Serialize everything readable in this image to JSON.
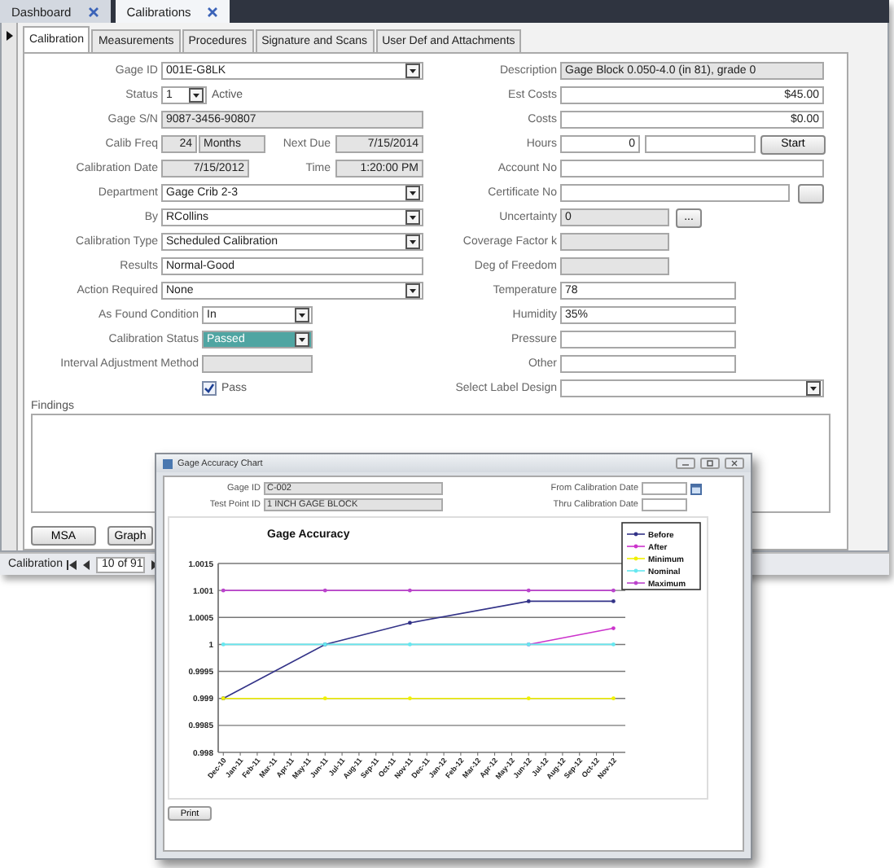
{
  "document_tabs": [
    {
      "label": "Dashboard",
      "selected": false
    },
    {
      "label": "Calibrations",
      "selected": true
    }
  ],
  "form_tabs": [
    {
      "label": "Calibration",
      "selected": true
    },
    {
      "label": "Measurements",
      "selected": false
    },
    {
      "label": "Procedures",
      "selected": false
    },
    {
      "label": "Signature and Scans",
      "selected": false
    },
    {
      "label": "User Def and Attachments",
      "selected": false
    }
  ],
  "left_fields": [
    {
      "kind": "combo",
      "label": "Gage ID",
      "value": "001E-G8LK"
    },
    {
      "kind": "status",
      "label": "Status",
      "value": "1",
      "note": "Active"
    },
    {
      "kind": "readonly",
      "label": "Gage S/N",
      "value": "9087-3456-90807"
    },
    {
      "kind": "pair",
      "label": "Calib Freq",
      "value": "24",
      "unit": "Months",
      "label2": "Next Due",
      "value2": "7/15/2014"
    },
    {
      "kind": "pair",
      "label": "Calibration Date",
      "value": "7/15/2012",
      "label2": "Time",
      "value2": "1:20:00 PM"
    },
    {
      "kind": "combo",
      "label": "Department",
      "value": "Gage Crib 2-3"
    },
    {
      "kind": "combo",
      "label": "By",
      "value": "RCollins"
    },
    {
      "kind": "combo",
      "label": "Calibration Type",
      "value": "Scheduled Calibration"
    },
    {
      "kind": "text",
      "label": "Results",
      "value": "Normal-Good"
    },
    {
      "kind": "combo",
      "label": "Action Required",
      "value": "None"
    },
    {
      "kind": "combo-narrow",
      "label": "As Found Condition",
      "value": "In",
      "highlighted": false
    },
    {
      "kind": "combo-narrow",
      "label": "Calibration Status",
      "value": "Passed",
      "highlighted": true
    },
    {
      "kind": "readonly-narrow",
      "label": "Interval Adjustment Method"
    },
    {
      "kind": "checkbox",
      "label": "Pass",
      "checked": true
    }
  ],
  "right_fields": [
    {
      "kind": "readonly",
      "label": "Description",
      "value": "Gage Block 0.050-4.0 (in 81), grade 0"
    },
    {
      "kind": "text-right",
      "label": "Est Costs",
      "value": "$45.00"
    },
    {
      "kind": "text-right",
      "label": "Costs",
      "value": "$0.00"
    },
    {
      "kind": "hours",
      "label": "Hours",
      "value": "0",
      "button": "Start"
    },
    {
      "kind": "text",
      "label": "Account No"
    },
    {
      "kind": "text-button",
      "label": "Certificate No"
    },
    {
      "kind": "readonly-button",
      "label": "Uncertainty",
      "value": "0",
      "button": "..."
    },
    {
      "kind": "readonly-medium",
      "label": "Coverage Factor k"
    },
    {
      "kind": "readonly-medium",
      "label": "Deg of Freedom"
    },
    {
      "kind": "text-medium",
      "label": "Temperature",
      "value": "78"
    },
    {
      "kind": "text-medium",
      "label": "Humidity",
      "value": "35%"
    },
    {
      "kind": "text-medium",
      "label": "Pressure"
    },
    {
      "kind": "text-medium",
      "label": "Other"
    },
    {
      "kind": "combo",
      "label": "Select Label Design"
    }
  ],
  "findings": {
    "label": "Findings"
  },
  "buttons": [
    "MSA",
    "Graph"
  ],
  "navigation": {
    "label": "Calibration",
    "position": "10 of 91"
  },
  "chart_window": {
    "title": "Gage Accuracy Chart",
    "fields": [
      {
        "label": "Gage ID",
        "value": "C-002"
      },
      {
        "label": "Test Point ID",
        "value": "1 INCH GAGE BLOCK"
      }
    ],
    "date_fields": [
      {
        "label": "From Calibration Date",
        "calendar": true
      },
      {
        "label": "Thru Calibration Date",
        "calendar": false
      }
    ],
    "chart_data": {
      "type": "line",
      "title": "Gage Accuracy",
      "categories": [
        "Dec-10",
        "Jan-11",
        "Feb-11",
        "Mar-11",
        "Apr-11",
        "May-11",
        "Jun-11",
        "Jul-11",
        "Aug-11",
        "Sep-11",
        "Oct-11",
        "Nov-11",
        "Dec-11",
        "Jan-12",
        "Feb-12",
        "Mar-12",
        "Apr-12",
        "May-12",
        "Jun-12",
        "Jul-12",
        "Aug-12",
        "Sep-12",
        "Oct-12",
        "Nov-12"
      ],
      "series": [
        {
          "name": "Before",
          "color": "#333388",
          "values": [
            0.999,
            null,
            null,
            null,
            null,
            null,
            1,
            null,
            null,
            null,
            null,
            1.0004,
            null,
            null,
            null,
            null,
            null,
            null,
            1.0008,
            null,
            null,
            null,
            null,
            1.0008
          ]
        },
        {
          "name": "After",
          "color": "#cc33cc",
          "values": [
            null,
            null,
            null,
            null,
            null,
            null,
            null,
            null,
            null,
            null,
            null,
            null,
            null,
            null,
            null,
            null,
            null,
            null,
            1,
            null,
            null,
            null,
            null,
            1.0003
          ]
        },
        {
          "name": "Minimum",
          "color": "#f0f000",
          "values": [
            0.999,
            null,
            null,
            null,
            null,
            null,
            0.999,
            null,
            null,
            null,
            null,
            0.999,
            null,
            null,
            null,
            null,
            null,
            null,
            0.999,
            null,
            null,
            null,
            null,
            0.999
          ]
        },
        {
          "name": "Nominal",
          "color": "#66e8f0",
          "values": [
            1,
            null,
            null,
            null,
            null,
            null,
            1,
            null,
            null,
            null,
            null,
            1,
            null,
            null,
            null,
            null,
            null,
            null,
            1,
            null,
            null,
            null,
            null,
            1
          ]
        },
        {
          "name": "Maximum",
          "color": "#bb44cc",
          "values": [
            1.001,
            null,
            null,
            null,
            null,
            null,
            1.001,
            null,
            null,
            null,
            null,
            1.001,
            null,
            null,
            null,
            null,
            null,
            null,
            1.001,
            null,
            null,
            null,
            null,
            1.001
          ]
        }
      ],
      "ylim": [
        0.998,
        1.0015
      ],
      "grid": true,
      "legend": "top-right",
      "yticks": [
        0.998,
        0.9985,
        0.999,
        0.9995,
        1,
        1.0005,
        1.001,
        1.0015
      ]
    },
    "print_button": "Print"
  }
}
